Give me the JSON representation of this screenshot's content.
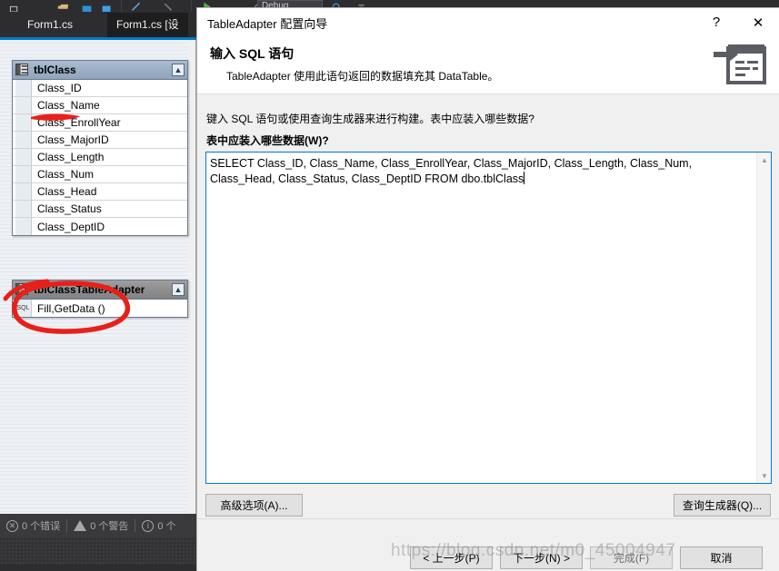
{
  "ide": {
    "tabs": [
      {
        "label": "Form1.cs",
        "active": false
      },
      {
        "label": "Form1.cs [设",
        "active": true
      }
    ],
    "toolbar": {
      "config_combo": "Debug"
    },
    "status": {
      "errors": "0 个错误",
      "warnings": "0 个警告",
      "messages": "0 个"
    }
  },
  "designer": {
    "table_card": {
      "title": "tblClass",
      "icon": "table-icon",
      "collapse_icon": "chevron-up-icon",
      "fields": [
        "Class_ID",
        "Class_Name",
        "Class_EnrollYear",
        "Class_MajorID",
        "Class_Length",
        "Class_Num",
        "Class_Head",
        "Class_Status",
        "Class_DeptID"
      ]
    },
    "adapter_card": {
      "title": "tblClassTableAdapter",
      "icon": "table-adapter-icon",
      "collapse_icon": "chevron-up-icon",
      "query_gutter_label": "SQL",
      "query_label": "Fill,GetData ()"
    }
  },
  "dialog": {
    "title": "TableAdapter 配置向导",
    "help_icon": "?",
    "close_icon": "✕",
    "banner_icon": "sql-statement-icon",
    "heading": "输入 SQL 语句",
    "subtext": "TableAdapter 使用此语句返回的数据填充其 DataTable。",
    "prompt": "键入 SQL 语句或使用查询生成器来进行构建。表中应装入哪些数据?",
    "field_label": "表中应装入哪些数据(W)?",
    "sql_text": "SELECT Class_ID, Class_Name, Class_EnrollYear, Class_MajorID, Class_Length, Class_Num, Class_Head, Class_Status, Class_DeptID FROM dbo.tblClass",
    "scroll_up_icon": "chevron-up-icon",
    "scroll_down_icon": "chevron-down-icon",
    "buttons": {
      "advanced": "高级选项(A)...",
      "query_builder": "查询生成器(Q)...",
      "previous": "< 上一步(P)",
      "next": "下一步(N) >",
      "finish": "完成(F)",
      "cancel": "取消"
    }
  },
  "watermark": {
    "text": "https://blog.csdn.net/m0_45004947"
  },
  "colors": {
    "accent": "#007acc",
    "focus_border": "#0078d7",
    "ide_chrome": "#2d2d30",
    "annotation_red": "#e8201a"
  }
}
